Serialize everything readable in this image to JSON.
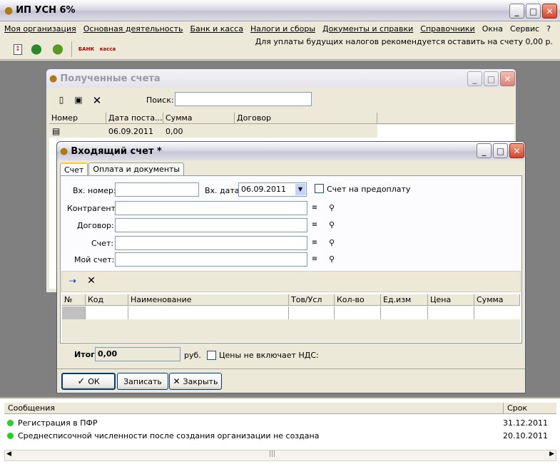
{
  "app": {
    "title": "ИП УСН 6%",
    "controls": {
      "minimize": "_",
      "maximize": "□",
      "close": "✕"
    }
  },
  "menu": [
    "Моя организация",
    "Основная деятельность",
    "Банк и касса",
    "Налоги и сборы",
    "Документы и справки",
    "Справочники",
    "Окна",
    "Сервис",
    "?"
  ],
  "toolbar": {
    "hint": "Для уплаты будущих налогов рекомендуется оставить на счету 0,00 р.",
    "tool_labels": {
      "bank": "БАНК",
      "cash": "касса"
    }
  },
  "received": {
    "title": "Полученные счета",
    "search_label": "Поиск:",
    "search_value": "",
    "columns": [
      "Номер",
      "Дата поста...",
      "Сумма",
      "Договор"
    ],
    "rows": [
      {
        "number": "",
        "date": "06.09.2011",
        "sum": "0,00",
        "contract": ""
      }
    ]
  },
  "invoice": {
    "title": "Входящий счет *",
    "tabs": [
      "Счет",
      "Оплата и документы"
    ],
    "in_number_label": "Вх. номер:",
    "in_number_value": "",
    "in_date_label": "Вх. дата:",
    "in_date_value": "06.09.2011",
    "prepay_label": "Счет на предоплату",
    "contractor_label": "Контрагент:",
    "contract_label": "Договор:",
    "account_label": "Счет:",
    "my_account_label": "Мой счет:",
    "grid_columns": [
      "№",
      "Код",
      "Наименование",
      "Тов/Усл",
      "Кол-во",
      "Ед.изм",
      "Цена",
      "Сумма"
    ],
    "total_label": "Итого:",
    "total_value": "0,00",
    "currency": "руб.",
    "vat_label": "Цены не включает НДС:",
    "ok_label": "ОК",
    "save_label": "Записать",
    "close_label": "Закрыть"
  },
  "messages": {
    "columns": [
      "Сообщения",
      "Срок"
    ],
    "rows": [
      {
        "text": "Регистрация в ПФР",
        "date": "31.12.2011",
        "status_color": "#22D322"
      },
      {
        "text": "Среднесписочной численности после создания организации не создана",
        "date": "20.10.2011",
        "status_color": "#22D322"
      }
    ]
  }
}
